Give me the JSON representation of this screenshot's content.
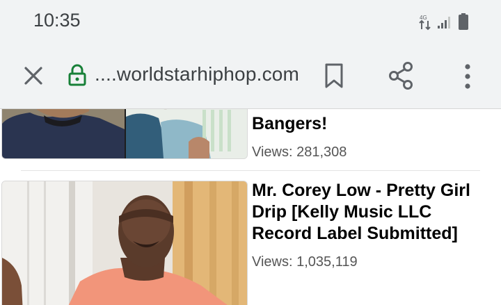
{
  "status_bar": {
    "time": "10:35",
    "icons": [
      "data-arrows-icon",
      "signal-icon",
      "battery-icon"
    ]
  },
  "url_bar": {
    "url": "....worldstarhiphop.com",
    "icons": [
      "close-icon",
      "lock-icon",
      "bookmark-icon",
      "share-icon",
      "more-vert-icon"
    ],
    "accent_color": "#188038"
  },
  "videos": [
    {
      "title": "Bangers!",
      "views": "Views: 281,308"
    },
    {
      "title": "Mr. Corey Low - Pretty Girl Drip [Kelly Music LLC Record Label Submitted]",
      "views": "Views: 1,035,119"
    }
  ]
}
